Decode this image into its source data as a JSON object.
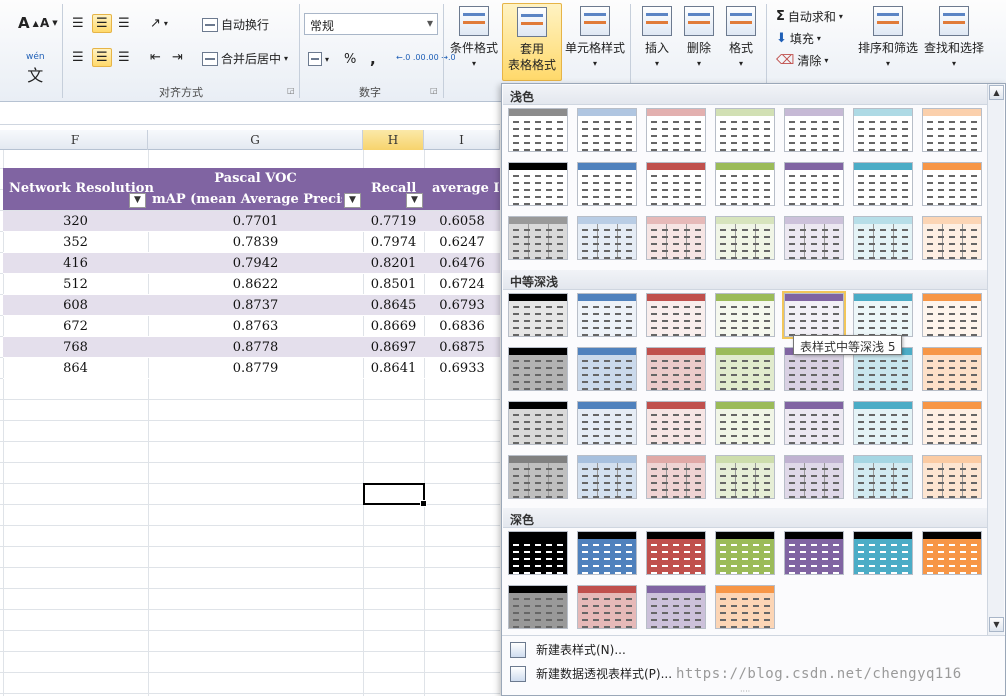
{
  "ribbon": {
    "font_group": {
      "grow_font": "A",
      "shrink_font": "A",
      "phonetic": "wén"
    },
    "align_group": {
      "label": "对齐方式",
      "wrap_text": "自动换行",
      "merge_center": "合并后居中"
    },
    "number_group": {
      "label": "数字",
      "format_value": "常规",
      "percent": "%",
      "comma": ",",
      "inc_decimal": "←.0 .00",
      "dec_decimal": ".00 →.0"
    },
    "styles_group": {
      "conditional_format": "条件格式",
      "format_as_table_line1": "套用",
      "format_as_table_line2": "表格格式",
      "cell_styles": "单元格样式"
    },
    "cells_group": {
      "insert": "插入",
      "delete": "删除",
      "format": "格式"
    },
    "editing_group": {
      "autosum": "自动求和",
      "fill": "填充",
      "clear": "清除",
      "sort_filter": "排序和筛选",
      "find_select": "查找和选择"
    }
  },
  "sheet": {
    "columns": [
      {
        "letter": "F",
        "selected": false
      },
      {
        "letter": "G",
        "selected": false
      },
      {
        "letter": "H",
        "selected": true
      },
      {
        "letter": "I",
        "selected": false
      }
    ],
    "header": {
      "col_f": "Network Resolution",
      "col_g_line1": "Pascal VOC",
      "col_g_line2": "mAP (mean Average Precisio",
      "col_h": "Recall",
      "col_i": "average Io"
    },
    "rows": [
      [
        "320",
        "0.7701",
        "0.7719",
        "0.6058"
      ],
      [
        "352",
        "0.7839",
        "0.7974",
        "0.6247"
      ],
      [
        "416",
        "0.7942",
        "0.8201",
        "0.6476"
      ],
      [
        "512",
        "0.8622",
        "0.8501",
        "0.6724"
      ],
      [
        "608",
        "0.8737",
        "0.8645",
        "0.6793"
      ],
      [
        "672",
        "0.8763",
        "0.8669",
        "0.6836"
      ],
      [
        "768",
        "0.8778",
        "0.8697",
        "0.6875"
      ],
      [
        "864",
        "0.8779",
        "0.8641",
        "0.6933"
      ]
    ],
    "header_color": "#8064a2",
    "band_color": "#e4dfec"
  },
  "gallery": {
    "sections": {
      "light": "浅色",
      "medium": "中等深浅",
      "dark": "深色"
    },
    "tooltip": "表样式中等深浅 5",
    "palette": [
      "#000000",
      "#4f81bd",
      "#c0504d",
      "#9bbb59",
      "#8064a2",
      "#4bacc6",
      "#f79646"
    ],
    "menu": {
      "new_table_style": "新建表样式(N)...",
      "new_pivot_style": "新建数据透视表样式(P)..."
    }
  },
  "watermark": "https://blog.csdn.net/chengyq116"
}
